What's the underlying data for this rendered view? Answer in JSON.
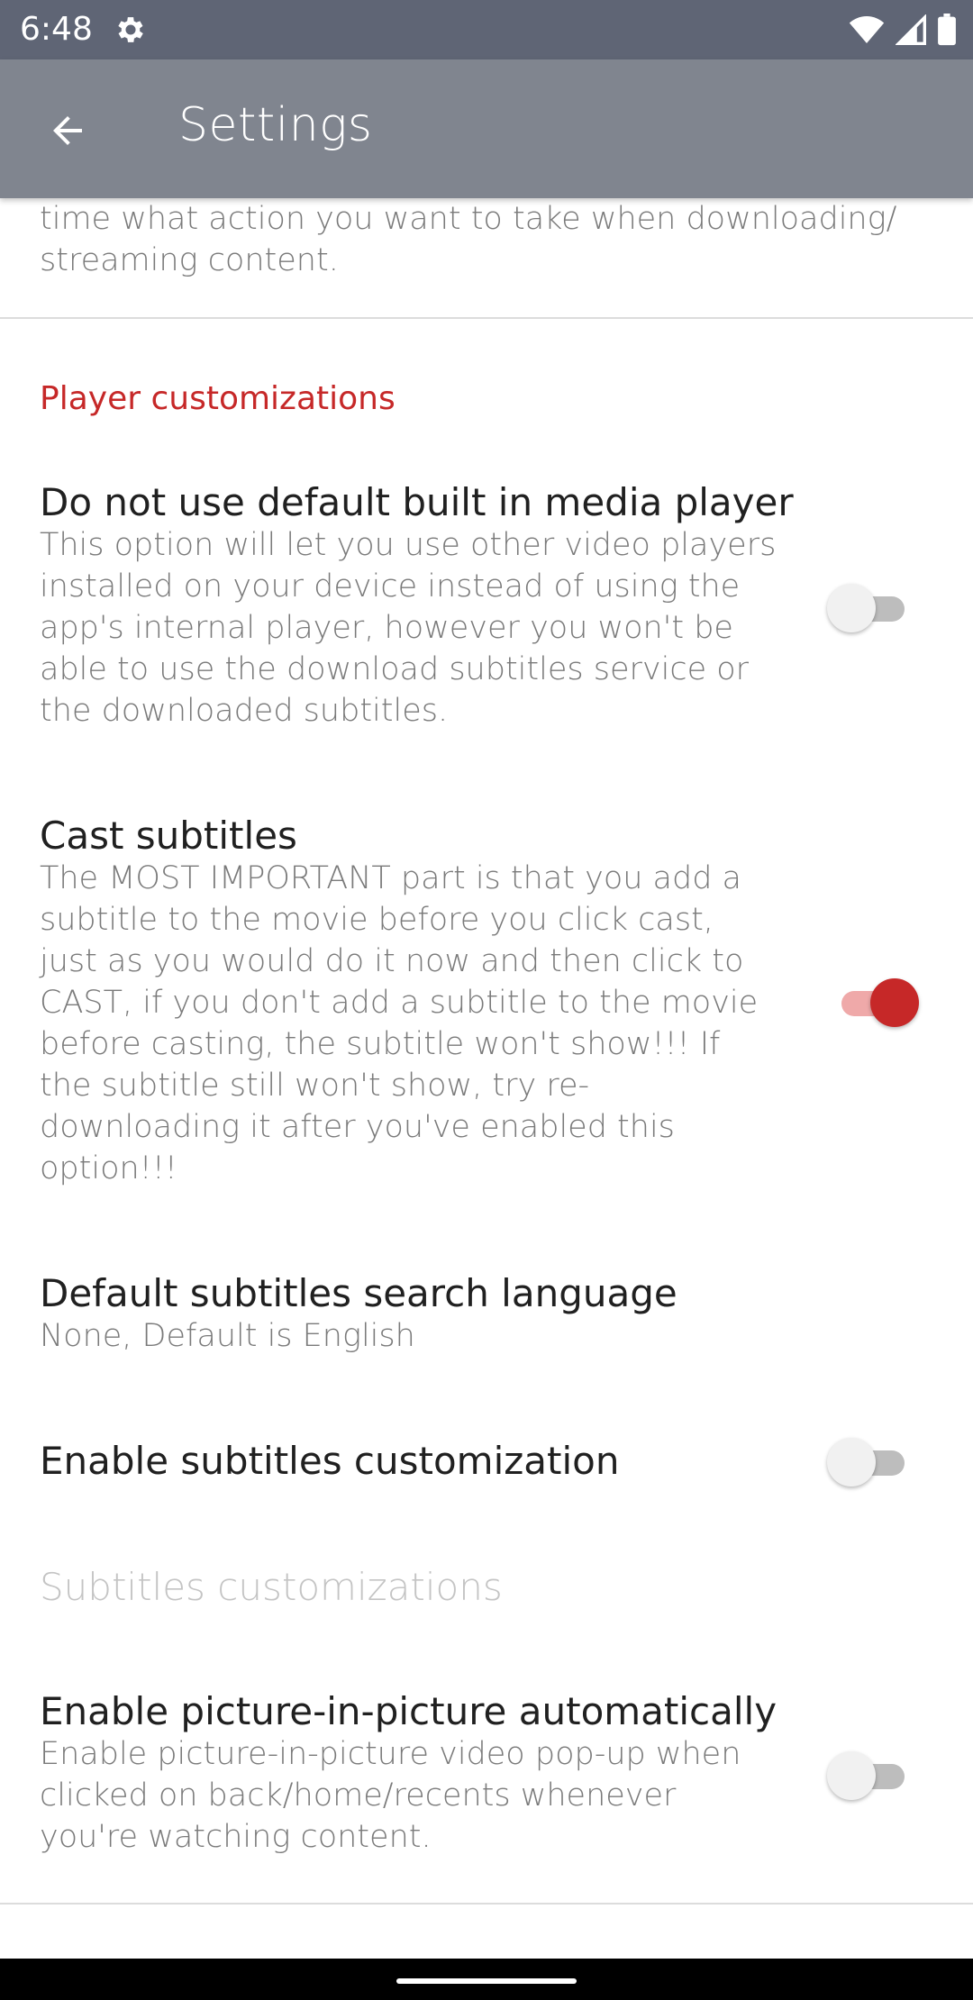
{
  "status_bar": {
    "time": "6:48",
    "icons": [
      "gear-icon",
      "wifi-icon",
      "signal-icon",
      "battery-icon"
    ]
  },
  "app_bar": {
    "back_icon": "arrow-left-icon",
    "title": "Settings"
  },
  "previous_item": {
    "summary_tail": "time what action you want to take when downloading/ streaming content."
  },
  "player_section": {
    "header": "Player customizations",
    "header_color": "#c62828",
    "items": [
      {
        "title": "Do not use default built in media player",
        "summary": "This option will let you use other video players installed on your device instead of using the app's internal player, however you won't be able to use the download subtitles service or the downloaded subtitles.",
        "switch": false
      },
      {
        "title": "Cast subtitles",
        "summary": "The MOST IMPORTANT part is that you add a subtitle to the movie before you click cast, just as you would do it now and then click to CAST, if you don't add a subtitle to the movie before casting, the subtitle won't show!!! If the subtitle still won't show, try re-downloading it after you've enabled this option!!!",
        "switch": true
      },
      {
        "title": "Default subtitles search language",
        "summary": "None, Default is English"
      },
      {
        "title": "Enable subtitles customization",
        "switch": false
      },
      {
        "title": "Subtitles customizations",
        "disabled": true
      },
      {
        "title": "Enable picture-in-picture automatically",
        "summary": "Enable picture-in-picture video pop-up when clicked on back/home/recents whenever you're watching content.",
        "switch": false
      }
    ]
  },
  "colors": {
    "status_bar": "#5f6575",
    "app_bar": "#80858f",
    "accent": "#c62828",
    "disabled_text": "#c4c4c4"
  }
}
